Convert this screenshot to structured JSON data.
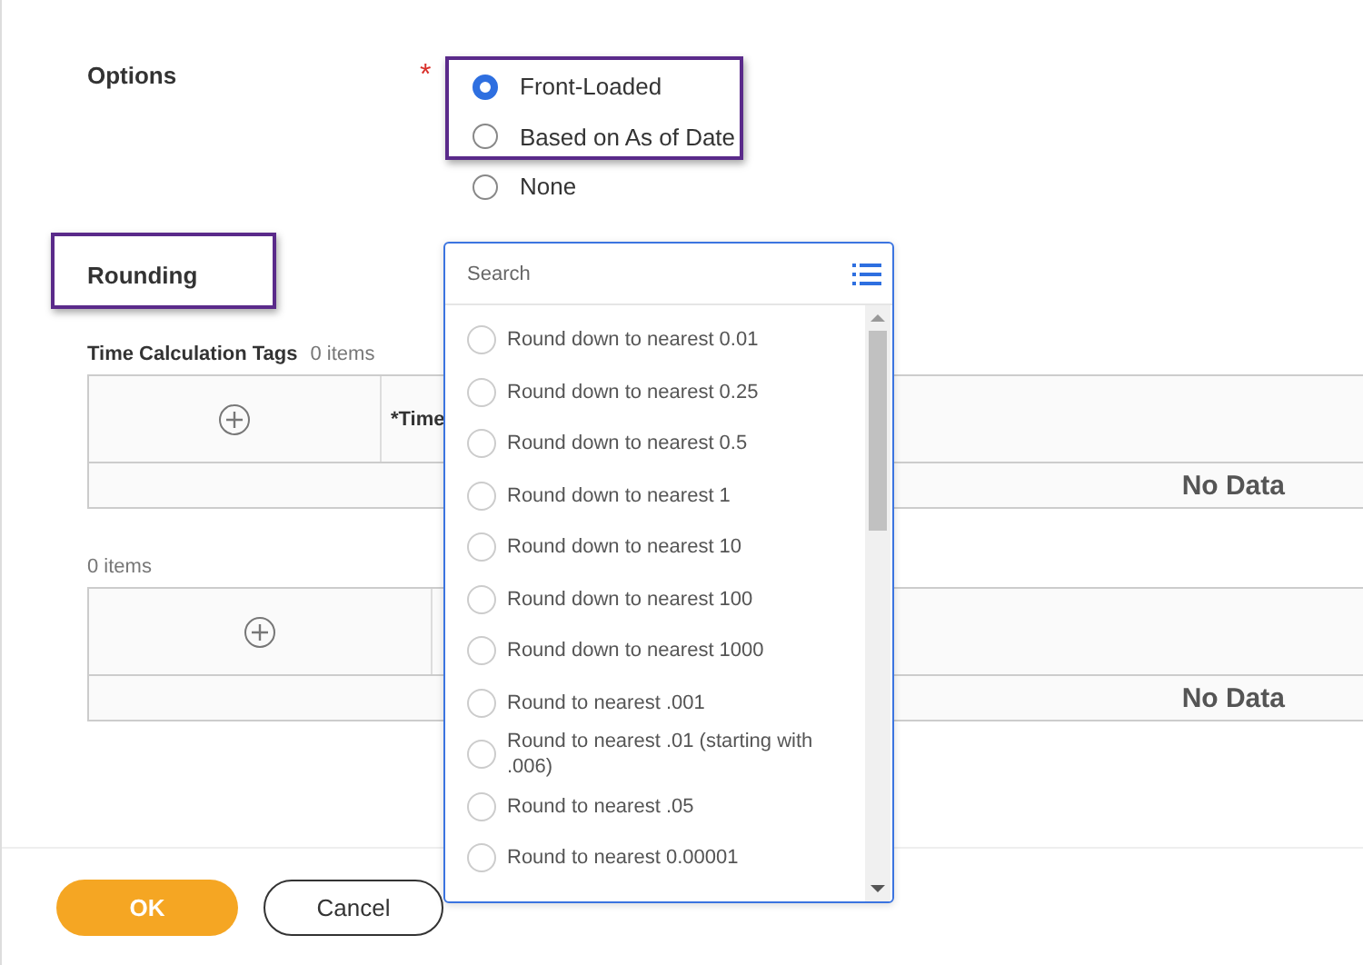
{
  "options": {
    "label": "Options",
    "required_mark": "*",
    "choices": [
      {
        "label": "Front-Loaded",
        "selected": true
      },
      {
        "label": "Based on As of Date",
        "selected": false
      },
      {
        "label": "None",
        "selected": false
      }
    ]
  },
  "rounding": {
    "label": "Rounding"
  },
  "tables": [
    {
      "title": "Time Calculation Tags",
      "count": "0 items",
      "column": "*Time",
      "empty_text": "No Data"
    },
    {
      "count": "0 items",
      "empty_text": "No Data"
    }
  ],
  "dropdown": {
    "placeholder": "Search",
    "items": [
      {
        "label": "Round down to nearest 0.01",
        "selected": false
      },
      {
        "label": "Round down to nearest 0.25",
        "selected": false
      },
      {
        "label": "Round down to nearest 0.5",
        "selected": false
      },
      {
        "label": "Round down to nearest 1",
        "selected": false
      },
      {
        "label": "Round down to nearest 10",
        "selected": false
      },
      {
        "label": "Round down to nearest 100",
        "selected": false
      },
      {
        "label": "Round down to nearest 1000",
        "selected": false
      },
      {
        "label": "Round to nearest .001",
        "selected": false
      },
      {
        "label": "Round to nearest .01 (starting with .006)",
        "selected": false
      },
      {
        "label": "Round to nearest .05",
        "selected": false
      },
      {
        "label": "Round to nearest 0.00001",
        "selected": false
      }
    ]
  },
  "buttons": [
    {
      "label": "OK",
      "kind": "primary"
    },
    {
      "label": "Cancel",
      "kind": "secondary"
    }
  ]
}
